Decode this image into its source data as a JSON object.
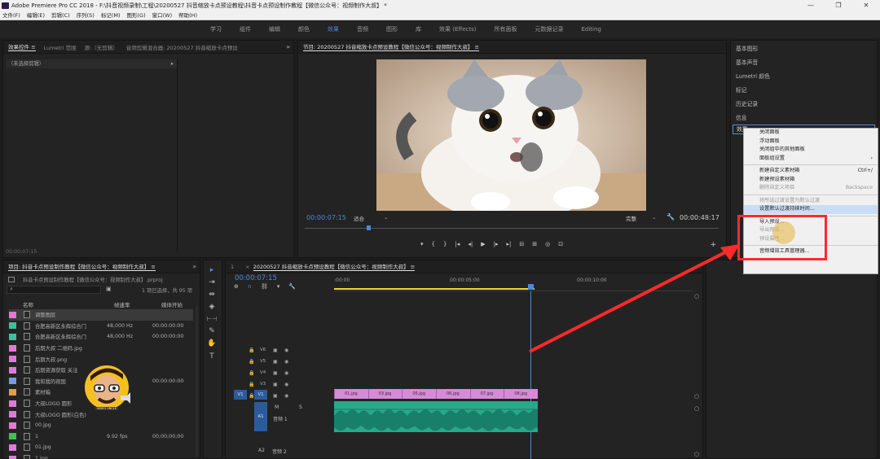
{
  "title_bar": {
    "text": "Adobe Premiere Pro CC 2018 - F:\\抖音视频录制\\工程\\20200527 抖音缩放卡点预设教程\\抖音卡点预设制作教程【微信公众号：视频制作大叔】 *",
    "min": "—",
    "max": "❐",
    "close": "✕"
  },
  "menubar": [
    "文件(F)",
    "编辑(E)",
    "剪辑(C)",
    "序列(S)",
    "标记(M)",
    "图形(G)",
    "窗口(W)",
    "帮助(H)"
  ],
  "workspaces": [
    {
      "label": "学习"
    },
    {
      "label": "组件"
    },
    {
      "label": "编辑"
    },
    {
      "label": "颜色"
    },
    {
      "label": "效果",
      "active": true
    },
    {
      "label": "音频"
    },
    {
      "label": "图形"
    },
    {
      "label": "库"
    },
    {
      "label": "效果 (Effects)"
    },
    {
      "label": "所有面板"
    },
    {
      "label": "元数据记录"
    },
    {
      "label": "Editing"
    }
  ],
  "source_panel": {
    "tabs": [
      "效果控件 ≡",
      "Lumetri 范围",
      "源:（无剪辑）",
      "音频剪辑混合器: 20200527 抖音缩放卡点预设"
    ],
    "overflow": "»",
    "no_clip": "（未选择剪辑）",
    "timecode": "00:00:07:15"
  },
  "program": {
    "title": "节目: 20200527 抖音缩放卡点预设教程【微信公众号：视频制作大叔】 ≡",
    "timecode": "00:00:07:15",
    "fit": "适合",
    "quality": "完整",
    "duration": "00:00:48:17",
    "buttons": [
      "▾",
      "{",
      "}",
      "|◂",
      "◂|",
      "▶",
      "|▸",
      "▸|",
      "⊟",
      "⊞",
      "◎",
      "⊡",
      "+"
    ]
  },
  "right_panel": {
    "items": [
      "基本图形",
      "基本声音",
      "Lumetri 颜色",
      "标记",
      "历史记录",
      "信息",
      "效果"
    ]
  },
  "context_menu": {
    "items": [
      {
        "label": "关闭面板"
      },
      {
        "label": "浮动面板"
      },
      {
        "label": "关闭组中的其他面板"
      },
      {
        "label": "面板组设置",
        "arrow": "›"
      },
      {
        "sep": true
      },
      {
        "label": "新建自定义素材箱",
        "shortcut": "Ctrl+/"
      },
      {
        "label": "新建预设素材箱"
      },
      {
        "label": "删除自定义项目",
        "shortcut": "Backspace",
        "disabled": true
      },
      {
        "sep": true
      },
      {
        "label": "将所选过渡设置为默认过渡",
        "disabled": true
      },
      {
        "label": "设置默认过渡持续时间...",
        "highlight": true
      },
      {
        "sep": true
      },
      {
        "label": "导入预设..."
      },
      {
        "label": "导出预设...",
        "disabled": true
      },
      {
        "label": "预设属性...",
        "disabled": true
      },
      {
        "sep": true
      },
      {
        "label": "音频增效工具管理器..."
      }
    ]
  },
  "project": {
    "title": "项目: 抖音卡点预设制作教程【微信公众号：视频制作大叔】 ≡",
    "overflow": "»",
    "file": "抖音卡点预设制作教程【微信公众号：视频制作大叔】.prproj",
    "selection": "1 项已选择，共 95 项",
    "columns": {
      "name": "名称",
      "fps": "帧速率",
      "start": "媒体开始"
    },
    "rows": [
      {
        "color": "#e07ad6",
        "name": "调整图层",
        "fps": "",
        "start": "",
        "selected": true
      },
      {
        "color": "#3fbf9f",
        "name": "合肥高新区永辉综合门",
        "fps": "48,000 Hz",
        "start": "00:00:00:00"
      },
      {
        "color": "#3fbf9f",
        "name": "合肥高新区永辉综合门",
        "fps": "48,000 Hz",
        "start": "00:00:00:00"
      },
      {
        "color": "#e07ad6",
        "name": "后期大叔 二维码.jpg",
        "fps": "",
        "start": ""
      },
      {
        "color": "#e07ad6",
        "name": "后期大叔.png",
        "fps": "",
        "start": ""
      },
      {
        "color": "#e07ad6",
        "name": "后期资源获取 关注",
        "fps": "",
        "start": ""
      },
      {
        "color": "#7a9ae0",
        "name": "我和我的祖国",
        "fps": "",
        "start": "00:00:00:00"
      },
      {
        "color": "#e0a040",
        "name": "素材箱",
        "fps": "",
        "start": ""
      },
      {
        "color": "#e07ad6",
        "name": "大叔LOGO 圆形",
        "fps": "",
        "start": ""
      },
      {
        "color": "#e07ad6",
        "name": "大叔LOGO 圆形(白色)",
        "fps": "",
        "start": ""
      },
      {
        "color": "#e07ad6",
        "name": "00.jpg",
        "fps": "",
        "start": ""
      },
      {
        "color": "#3fbf4f",
        "name": "1",
        "fps": "9.92 fps",
        "start": "00;00;00;00"
      },
      {
        "color": "#e07ad6",
        "name": "01.jpg",
        "fps": "",
        "start": ""
      },
      {
        "color": "#e07ad6",
        "name": "1.jpg",
        "fps": "",
        "start": ""
      }
    ]
  },
  "avatar": {
    "badge": "VIDEO UNCLE"
  },
  "timeline": {
    "tab": "20200527 抖音缩放卡点预设教程【微信公众号：视频制作大叔】 ≡",
    "tab_close": "×",
    "tab_num": "1",
    "timecode": "00:00:07:15",
    "ruler": [
      ":00:00",
      "00:00:05:00",
      "00:00:10:00"
    ],
    "video_tracks": [
      "V6",
      "V5",
      "V4",
      "V3",
      "V2",
      "V1"
    ],
    "src_v": "V1",
    "audio": {
      "src": "A1",
      "a1": "A1",
      "a1_name": "音频 1",
      "a2": "A2",
      "a2_name": "音频 2",
      "m": "M",
      "s": "S"
    },
    "clips": [
      "01.jpg",
      "03.jpg",
      "05.jpg",
      "06.jpg",
      "07.jpg",
      "08.jpg"
    ]
  },
  "tools": [
    "▸",
    "⇥",
    "⇹",
    "◈",
    "⊢⊣",
    "✎",
    "✋",
    "T"
  ],
  "colors": {
    "accent": "#4d8ad6",
    "clip": "#d78ad6",
    "audio": "#27a98a",
    "highlight_box": "#ff2a2a"
  }
}
